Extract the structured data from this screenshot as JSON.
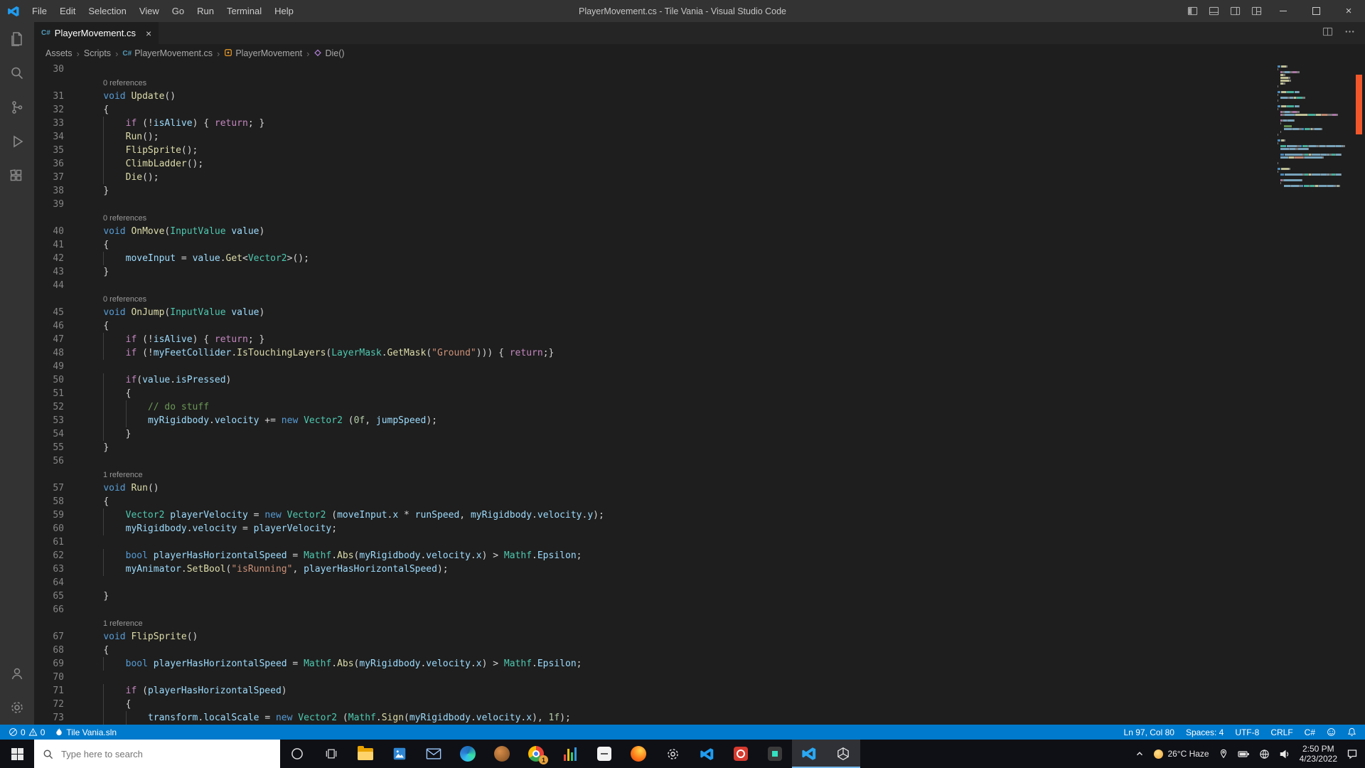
{
  "colors": {
    "accent": "#007acc",
    "ruler_marker": "#f1572b",
    "csharp_icon": "#519aba",
    "taskbar_active_underline": "#76b9ed"
  },
  "glyphs": {
    "close": "×",
    "crumb_sep": "›",
    "csharp": "C#"
  },
  "window": {
    "title": "PlayerMovement.cs - Tile Vania - Visual Studio Code",
    "menus": [
      "File",
      "Edit",
      "Selection",
      "View",
      "Go",
      "Run",
      "Terminal",
      "Help"
    ]
  },
  "tab_bar": {
    "active_tab": "PlayerMovement.cs"
  },
  "breadcrumbs": {
    "items": [
      {
        "label": "Assets"
      },
      {
        "label": "Scripts"
      },
      {
        "label": "PlayerMovement.cs"
      },
      {
        "label": "PlayerMovement"
      },
      {
        "label": "Die()"
      }
    ]
  },
  "editor": {
    "lines": [
      {
        "n": 30,
        "t": []
      },
      {
        "lens": "0 references"
      },
      {
        "n": 31,
        "t": [
          [
            "    ",
            "p"
          ],
          [
            "void",
            "kw"
          ],
          [
            " ",
            "p"
          ],
          [
            "Update",
            "fn"
          ],
          [
            "()",
            "p"
          ]
        ]
      },
      {
        "n": 32,
        "t": [
          [
            "    ",
            "p"
          ],
          [
            "{",
            "p"
          ]
        ]
      },
      {
        "n": 33,
        "t": [
          [
            "        ",
            "p"
          ],
          [
            "if",
            "ctrl"
          ],
          [
            " (!",
            "p"
          ],
          [
            "isAlive",
            "var"
          ],
          [
            ") { ",
            "p"
          ],
          [
            "return",
            "ctrl"
          ],
          [
            "; }",
            "p"
          ]
        ]
      },
      {
        "n": 34,
        "t": [
          [
            "        ",
            "p"
          ],
          [
            "Run",
            "fn"
          ],
          [
            "();",
            "p"
          ]
        ]
      },
      {
        "n": 35,
        "t": [
          [
            "        ",
            "p"
          ],
          [
            "FlipSprite",
            "fn"
          ],
          [
            "();",
            "p"
          ]
        ]
      },
      {
        "n": 36,
        "t": [
          [
            "        ",
            "p"
          ],
          [
            "ClimbLadder",
            "fn"
          ],
          [
            "();",
            "p"
          ]
        ]
      },
      {
        "n": 37,
        "t": [
          [
            "        ",
            "p"
          ],
          [
            "Die",
            "fn"
          ],
          [
            "();",
            "p"
          ]
        ]
      },
      {
        "n": 38,
        "t": [
          [
            "    ",
            "p"
          ],
          [
            "}",
            "p"
          ]
        ]
      },
      {
        "n": 39,
        "t": []
      },
      {
        "lens": "0 references"
      },
      {
        "n": 40,
        "t": [
          [
            "    ",
            "p"
          ],
          [
            "void",
            "kw"
          ],
          [
            " ",
            "p"
          ],
          [
            "OnMove",
            "fn"
          ],
          [
            "(",
            "p"
          ],
          [
            "InputValue",
            "type"
          ],
          [
            " ",
            "p"
          ],
          [
            "value",
            "var"
          ],
          [
            ")",
            "p"
          ]
        ]
      },
      {
        "n": 41,
        "t": [
          [
            "    ",
            "p"
          ],
          [
            "{",
            "p"
          ]
        ]
      },
      {
        "n": 42,
        "t": [
          [
            "        ",
            "p"
          ],
          [
            "moveInput",
            "var"
          ],
          [
            " = ",
            "p"
          ],
          [
            "value",
            "var"
          ],
          [
            ".",
            "p"
          ],
          [
            "Get",
            "fn"
          ],
          [
            "<",
            "p"
          ],
          [
            "Vector2",
            "type"
          ],
          [
            ">();",
            "p"
          ]
        ]
      },
      {
        "n": 43,
        "t": [
          [
            "    ",
            "p"
          ],
          [
            "}",
            "p"
          ]
        ]
      },
      {
        "n": 44,
        "t": []
      },
      {
        "lens": "0 references"
      },
      {
        "n": 45,
        "t": [
          [
            "    ",
            "p"
          ],
          [
            "void",
            "kw"
          ],
          [
            " ",
            "p"
          ],
          [
            "OnJump",
            "fn"
          ],
          [
            "(",
            "p"
          ],
          [
            "InputValue",
            "type"
          ],
          [
            " ",
            "p"
          ],
          [
            "value",
            "var"
          ],
          [
            ")",
            "p"
          ]
        ]
      },
      {
        "n": 46,
        "t": [
          [
            "    ",
            "p"
          ],
          [
            "{",
            "p"
          ]
        ]
      },
      {
        "n": 47,
        "t": [
          [
            "        ",
            "p"
          ],
          [
            "if",
            "ctrl"
          ],
          [
            " (!",
            "p"
          ],
          [
            "isAlive",
            "var"
          ],
          [
            ") { ",
            "p"
          ],
          [
            "return",
            "ctrl"
          ],
          [
            "; }",
            "p"
          ]
        ]
      },
      {
        "n": 48,
        "t": [
          [
            "        ",
            "p"
          ],
          [
            "if",
            "ctrl"
          ],
          [
            " (!",
            "p"
          ],
          [
            "myFeetCollider",
            "var"
          ],
          [
            ".",
            "p"
          ],
          [
            "IsTouchingLayers",
            "fn"
          ],
          [
            "(",
            "p"
          ],
          [
            "LayerMask",
            "type"
          ],
          [
            ".",
            "p"
          ],
          [
            "GetMask",
            "fn"
          ],
          [
            "(",
            "p"
          ],
          [
            "\"Ground\"",
            "str"
          ],
          [
            "))) { ",
            "p"
          ],
          [
            "return",
            "ctrl"
          ],
          [
            ";}",
            "p"
          ]
        ]
      },
      {
        "n": 49,
        "t": []
      },
      {
        "n": 50,
        "t": [
          [
            "        ",
            "p"
          ],
          [
            "if",
            "ctrl"
          ],
          [
            "(",
            "p"
          ],
          [
            "value",
            "var"
          ],
          [
            ".",
            "p"
          ],
          [
            "isPressed",
            "var"
          ],
          [
            ")",
            "p"
          ]
        ]
      },
      {
        "n": 51,
        "t": [
          [
            "        ",
            "p"
          ],
          [
            "{",
            "p"
          ]
        ]
      },
      {
        "n": 52,
        "t": [
          [
            "            ",
            "p"
          ],
          [
            "// do stuff",
            "com"
          ]
        ]
      },
      {
        "n": 53,
        "t": [
          [
            "            ",
            "p"
          ],
          [
            "myRigidbody",
            "var"
          ],
          [
            ".",
            "p"
          ],
          [
            "velocity",
            "var"
          ],
          [
            " += ",
            "p"
          ],
          [
            "new",
            "kw"
          ],
          [
            " ",
            "p"
          ],
          [
            "Vector2",
            "type"
          ],
          [
            " (",
            "p"
          ],
          [
            "0f",
            "num"
          ],
          [
            ", ",
            "p"
          ],
          [
            "jumpSpeed",
            "var"
          ],
          [
            ");",
            "p"
          ]
        ]
      },
      {
        "n": 54,
        "t": [
          [
            "        ",
            "p"
          ],
          [
            "}",
            "p"
          ]
        ]
      },
      {
        "n": 55,
        "t": [
          [
            "    ",
            "p"
          ],
          [
            "}",
            "p"
          ]
        ]
      },
      {
        "n": 56,
        "t": []
      },
      {
        "lens": "1 reference"
      },
      {
        "n": 57,
        "t": [
          [
            "    ",
            "p"
          ],
          [
            "void",
            "kw"
          ],
          [
            " ",
            "p"
          ],
          [
            "Run",
            "fn"
          ],
          [
            "()",
            "p"
          ]
        ]
      },
      {
        "n": 58,
        "t": [
          [
            "    ",
            "p"
          ],
          [
            "{",
            "p"
          ]
        ]
      },
      {
        "n": 59,
        "t": [
          [
            "        ",
            "p"
          ],
          [
            "Vector2",
            "type"
          ],
          [
            " ",
            "p"
          ],
          [
            "playerVelocity",
            "var"
          ],
          [
            " = ",
            "p"
          ],
          [
            "new",
            "kw"
          ],
          [
            " ",
            "p"
          ],
          [
            "Vector2",
            "type"
          ],
          [
            " (",
            "p"
          ],
          [
            "moveInput",
            "var"
          ],
          [
            ".",
            "p"
          ],
          [
            "x",
            "var"
          ],
          [
            " * ",
            "p"
          ],
          [
            "runSpeed",
            "var"
          ],
          [
            ", ",
            "p"
          ],
          [
            "myRigidbody",
            "var"
          ],
          [
            ".",
            "p"
          ],
          [
            "velocity",
            "var"
          ],
          [
            ".",
            "p"
          ],
          [
            "y",
            "var"
          ],
          [
            ");",
            "p"
          ]
        ]
      },
      {
        "n": 60,
        "t": [
          [
            "        ",
            "p"
          ],
          [
            "myRigidbody",
            "var"
          ],
          [
            ".",
            "p"
          ],
          [
            "velocity",
            "var"
          ],
          [
            " = ",
            "p"
          ],
          [
            "playerVelocity",
            "var"
          ],
          [
            ";",
            "p"
          ]
        ]
      },
      {
        "n": 61,
        "t": []
      },
      {
        "n": 62,
        "t": [
          [
            "        ",
            "p"
          ],
          [
            "bool",
            "kw"
          ],
          [
            " ",
            "p"
          ],
          [
            "playerHasHorizontalSpeed",
            "var"
          ],
          [
            " = ",
            "p"
          ],
          [
            "Mathf",
            "type"
          ],
          [
            ".",
            "p"
          ],
          [
            "Abs",
            "fn"
          ],
          [
            "(",
            "p"
          ],
          [
            "myRigidbody",
            "var"
          ],
          [
            ".",
            "p"
          ],
          [
            "velocity",
            "var"
          ],
          [
            ".",
            "p"
          ],
          [
            "x",
            "var"
          ],
          [
            ") > ",
            "p"
          ],
          [
            "Mathf",
            "type"
          ],
          [
            ".",
            "p"
          ],
          [
            "Epsilon",
            "var"
          ],
          [
            ";",
            "p"
          ]
        ]
      },
      {
        "n": 63,
        "t": [
          [
            "        ",
            "p"
          ],
          [
            "myAnimator",
            "var"
          ],
          [
            ".",
            "p"
          ],
          [
            "SetBool",
            "fn"
          ],
          [
            "(",
            "p"
          ],
          [
            "\"isRunning\"",
            "str"
          ],
          [
            ", ",
            "p"
          ],
          [
            "playerHasHorizontalSpeed",
            "var"
          ],
          [
            ");",
            "p"
          ]
        ]
      },
      {
        "n": 64,
        "t": []
      },
      {
        "n": 65,
        "t": [
          [
            "    ",
            "p"
          ],
          [
            "}",
            "p"
          ]
        ]
      },
      {
        "n": 66,
        "t": []
      },
      {
        "lens": "1 reference"
      },
      {
        "n": 67,
        "t": [
          [
            "    ",
            "p"
          ],
          [
            "void",
            "kw"
          ],
          [
            " ",
            "p"
          ],
          [
            "FlipSprite",
            "fn"
          ],
          [
            "()",
            "p"
          ]
        ]
      },
      {
        "n": 68,
        "t": [
          [
            "    ",
            "p"
          ],
          [
            "{",
            "p"
          ]
        ]
      },
      {
        "n": 69,
        "t": [
          [
            "        ",
            "p"
          ],
          [
            "bool",
            "kw"
          ],
          [
            " ",
            "p"
          ],
          [
            "playerHasHorizontalSpeed",
            "var"
          ],
          [
            " = ",
            "p"
          ],
          [
            "Mathf",
            "type"
          ],
          [
            ".",
            "p"
          ],
          [
            "Abs",
            "fn"
          ],
          [
            "(",
            "p"
          ],
          [
            "myRigidbody",
            "var"
          ],
          [
            ".",
            "p"
          ],
          [
            "velocity",
            "var"
          ],
          [
            ".",
            "p"
          ],
          [
            "x",
            "var"
          ],
          [
            ") > ",
            "p"
          ],
          [
            "Mathf",
            "type"
          ],
          [
            ".",
            "p"
          ],
          [
            "Epsilon",
            "var"
          ],
          [
            ";",
            "p"
          ]
        ]
      },
      {
        "n": 70,
        "t": []
      },
      {
        "n": 71,
        "t": [
          [
            "        ",
            "p"
          ],
          [
            "if",
            "ctrl"
          ],
          [
            " (",
            "p"
          ],
          [
            "playerHasHorizontalSpeed",
            "var"
          ],
          [
            ")",
            "p"
          ]
        ]
      },
      {
        "n": 72,
        "t": [
          [
            "        ",
            "p"
          ],
          [
            "{",
            "p"
          ]
        ]
      },
      {
        "n": 73,
        "t": [
          [
            "            ",
            "p"
          ],
          [
            "transform",
            "var"
          ],
          [
            ".",
            "p"
          ],
          [
            "localScale",
            "var"
          ],
          [
            " = ",
            "p"
          ],
          [
            "new",
            "kw"
          ],
          [
            " ",
            "p"
          ],
          [
            "Vector2",
            "type"
          ],
          [
            " (",
            "p"
          ],
          [
            "Mathf",
            "type"
          ],
          [
            ".",
            "p"
          ],
          [
            "Sign",
            "fn"
          ],
          [
            "(",
            "p"
          ],
          [
            "myRigidbody",
            "var"
          ],
          [
            ".",
            "p"
          ],
          [
            "velocity",
            "var"
          ],
          [
            ".",
            "p"
          ],
          [
            "x",
            "var"
          ],
          [
            "), ",
            "p"
          ],
          [
            "1f",
            "num"
          ],
          [
            ");",
            "p"
          ]
        ]
      }
    ]
  },
  "status_bar": {
    "errors": "0",
    "warnings": "0",
    "solution": "Tile Vania.sln",
    "line_col": "Ln 97, Col 80",
    "indentation": "Spaces: 4",
    "encoding": "UTF-8",
    "eol": "CRLF",
    "language": "C#"
  },
  "taskbar": {
    "search_placeholder": "Type here to search",
    "chrome_badge": "1",
    "apps": [
      "file-explorer",
      "photos",
      "mail",
      "edge",
      "amber-app",
      "chrome",
      "audio-mixer",
      "white-app",
      "firefox",
      "settings",
      "vscode",
      "red-app",
      "dark-app",
      "vscode-active",
      "unity-active"
    ]
  },
  "tray": {
    "weather": "26°C Haze",
    "time": "2:50 PM",
    "date": "4/23/2022"
  }
}
